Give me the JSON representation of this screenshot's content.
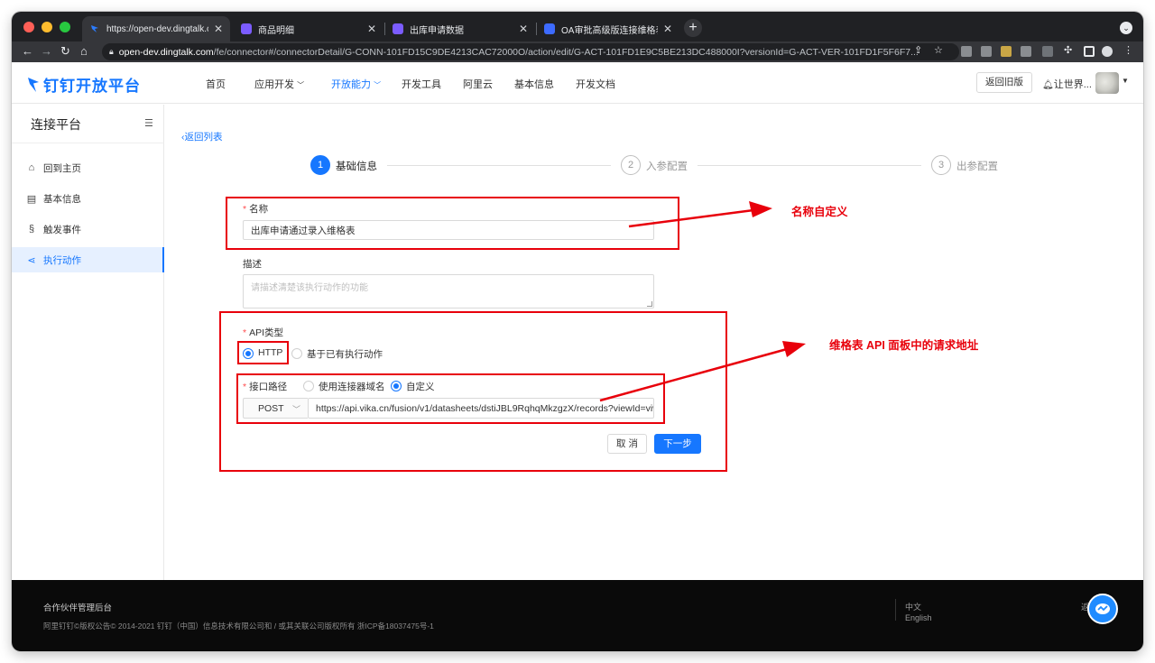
{
  "browser": {
    "tabs": [
      {
        "title": "https://open-dev.dingtalk.com",
        "favicon_color": "#2b7cff"
      },
      {
        "title": "商品明细",
        "favicon_color": "#7b5cff"
      },
      {
        "title": "出库申请数据",
        "favicon_color": "#7b5cff"
      },
      {
        "title": "OA审批高级版连接维格表(使用",
        "favicon_color": "#3d6bff"
      }
    ],
    "url_host": "open-dev.dingtalk.com",
    "url_path": "/fe/connector#/connectorDetail/G-CONN-101FD15C9DE4213CAC72000O/action/edit/G-ACT-101FD1E9C5BE213DC488000I?versionId=G-ACT-VER-101FD1F5F6F7..."
  },
  "header": {
    "logo_text": "钉钉开放平台",
    "nav": [
      "首页",
      "应用开发",
      "开放能力",
      "开发工具",
      "阿里云",
      "基本信息",
      "开发文档"
    ],
    "active_nav": "开放能力",
    "old_version_button": "返回旧版",
    "user_name": "让世界..."
  },
  "sidebar": {
    "title": "连接平台",
    "items": [
      {
        "label": "回到主页",
        "icon": "home-icon"
      },
      {
        "label": "基本信息",
        "icon": "document-icon"
      },
      {
        "label": "触发事件",
        "icon": "trigger-icon"
      },
      {
        "label": "执行动作",
        "icon": "action-icon"
      }
    ],
    "active_item": "执行动作"
  },
  "content": {
    "back_link": "返回列表",
    "steps": [
      {
        "number": "1",
        "label": "基础信息"
      },
      {
        "number": "2",
        "label": "入参配置"
      },
      {
        "number": "3",
        "label": "出参配置"
      }
    ],
    "current_step": 1,
    "form": {
      "name_label": "名称",
      "name_value": "出库申请通过录入维格表",
      "description_label": "描述",
      "description_placeholder": "请描述清楚该执行动作的功能",
      "api_type_label": "API类型",
      "api_type_options": [
        "HTTP",
        "基于已有执行动作"
      ],
      "api_type_selected": "HTTP",
      "path_label": "接口路径",
      "path_options": [
        "使用连接器域名",
        "自定义"
      ],
      "path_selected": "自定义",
      "method": "POST",
      "url": "https://api.vika.cn/fusion/v1/datasheets/dstiJBL9RqhqMkzgzX/records?viewId=viw"
    },
    "buttons": {
      "cancel": "取 消",
      "next": "下一步"
    }
  },
  "annotations": {
    "name_note": "名称自定义",
    "api_note": "维格表 API 面板中的请求地址",
    "highlight_color": "#e8000b"
  },
  "footer": {
    "title": "合作伙伴管理后台",
    "copyright": "阿里钉钉©版权公告© 2014-2021 钉钉（中国）信息技术有限公司和 / 或其关联公司版权所有 浙ICP备18037475号-1",
    "languages": [
      "中文",
      "English"
    ],
    "truncated_text": "返"
  }
}
